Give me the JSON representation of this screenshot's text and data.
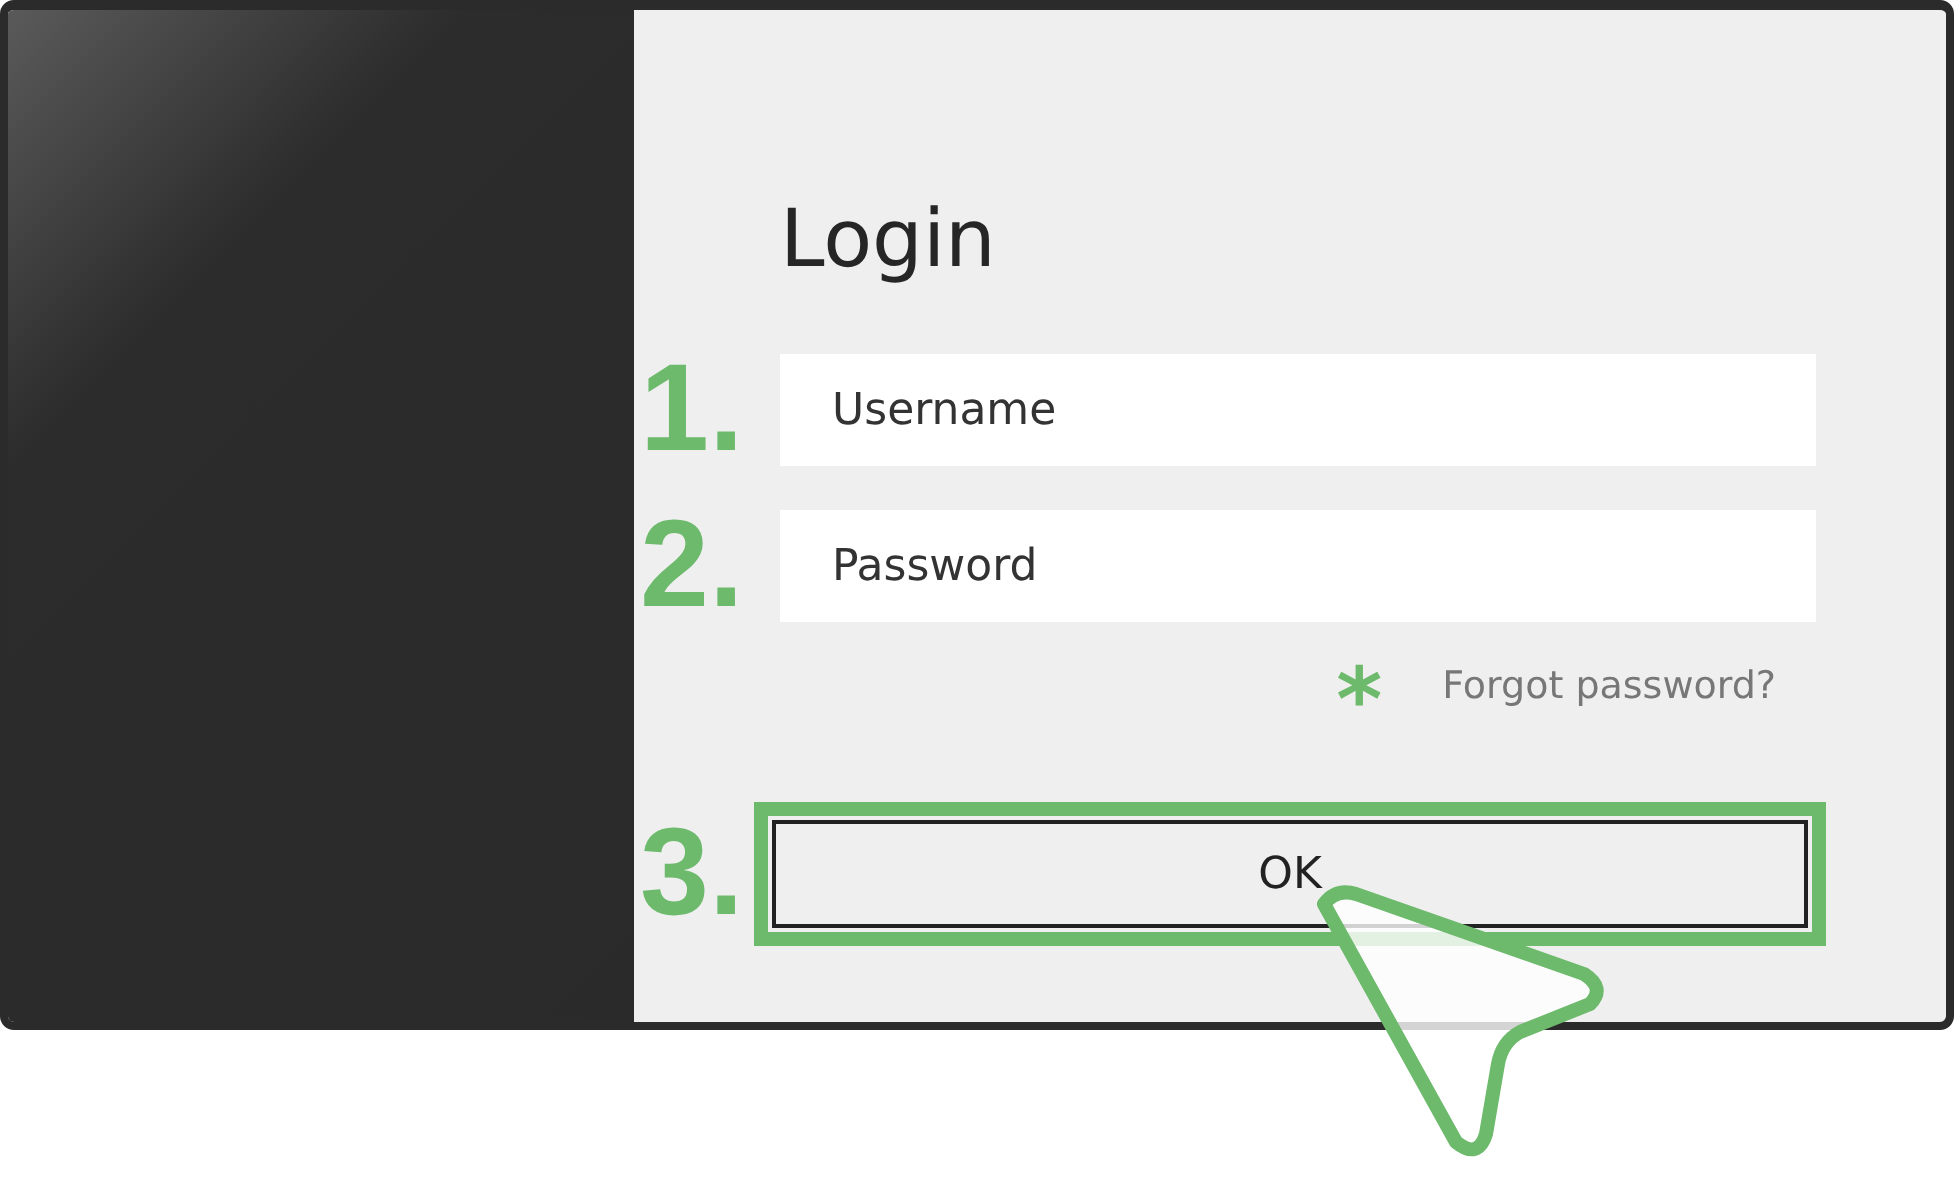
{
  "login": {
    "title": "Login",
    "fields": [
      {
        "step": "1.",
        "placeholder": "Username"
      },
      {
        "step": "2.",
        "placeholder": "Password"
      }
    ],
    "forgot_link": {
      "marker": "*",
      "label": "Forgot password?"
    },
    "ok_button": {
      "step": "3.",
      "label": "OK",
      "highlighted": true
    }
  }
}
